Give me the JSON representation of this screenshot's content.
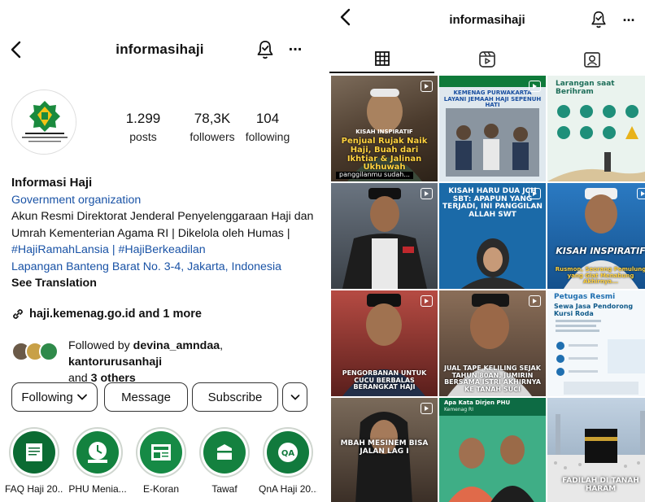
{
  "left": {
    "header": {
      "username": "informasihaji",
      "more_icon": "..."
    },
    "stats": {
      "posts": {
        "value": "1.299",
        "label": "posts"
      },
      "followers": {
        "value": "78,3K",
        "label": "followers"
      },
      "following": {
        "value": "104",
        "label": "following"
      }
    },
    "bio": {
      "name": "Informasi Haji",
      "category": "Government organization",
      "line1": "Akun Resmi Direktorat Jenderal Penyelenggaraan Haji dan",
      "line2": "Umrah Kementerian Agama RI | Dikelola oleh Humas |",
      "hashtags": "#HajiRamahLansia | #HajiBerkeadilan",
      "address": "Lapangan Banteng Barat No. 3-4, Jakarta, Indonesia",
      "see_translation": "See Translation"
    },
    "website": "haji.kemenag.go.id and 1 more",
    "followed_by": {
      "prefix": "Followed by ",
      "user1": "devina_amndaa",
      "sep": ", ",
      "user2": "kantorurusanhaji",
      "and": "and ",
      "others": "3 others"
    },
    "buttons": {
      "following": "Following",
      "message": "Message",
      "subscribe": "Subscribe"
    },
    "highlights": [
      {
        "label": "FAQ Haji 20..."
      },
      {
        "label": "PHU Menia..."
      },
      {
        "label": "E-Koran"
      },
      {
        "label": "Tawaf"
      },
      {
        "label": "QnA Haji 20..."
      }
    ],
    "logo_text": "DIREKTORAT JENDERAL PENYELENGGARAAN HAJI DAN UMRAH"
  },
  "right": {
    "header": {
      "username": "informasihaji",
      "more_icon": "..."
    },
    "tabs": [
      "grid-tab",
      "reels-tab",
      "tagged-tab"
    ],
    "posts": [
      {
        "caption": "KISAH INSPIRATIF",
        "caption2": "Penjual Rujak Naik Haji, Buah dari Ikhtiar & Jalinan Ukhuwah",
        "footer": "panggilanmu sudah..."
      },
      {
        "caption": "KEMENAG PURWAKARTA LAYANI JEMAAH HAJI SEPENUH HATI"
      },
      {
        "caption": "Larangan saat Berihram"
      },
      {
        "caption": ""
      },
      {
        "caption": "KISAH HARU DUA JCH SBT: APAPUN YANG TERJADI, INI PANGGILAN ALLAH SWT"
      },
      {
        "caption": "KISAH INSPIRATIF",
        "caption2": "Rusmon, Seorang Pemulung yang Giat Menabung Akhirnya..."
      },
      {
        "caption": "PENGORBANAN UNTUK CUCU BERBALAS BERANGKAT HAJI"
      },
      {
        "caption": "JUAL TAPE KELILING SEJAK TAHUN 80AN, JUMIRIN BERSAMA ISTRI AKHIRNYA KE TANAH SUCI"
      },
      {
        "caption": "Petugas Resmi",
        "caption2": "Sewa Jasa Pendorong Kursi Roda"
      },
      {
        "caption": "MBAH MESINEM BISA JALAN LAG I"
      },
      {
        "caption": "Apa Kata Dirjen PHU",
        "caption2": "Kemenag RI"
      },
      {
        "caption": "FADILAH DI TANAH HARAM"
      }
    ]
  },
  "colors": {
    "link": "#1a53a6",
    "brand_green": "#0f7a3a",
    "teal": "#1f8f7a"
  }
}
